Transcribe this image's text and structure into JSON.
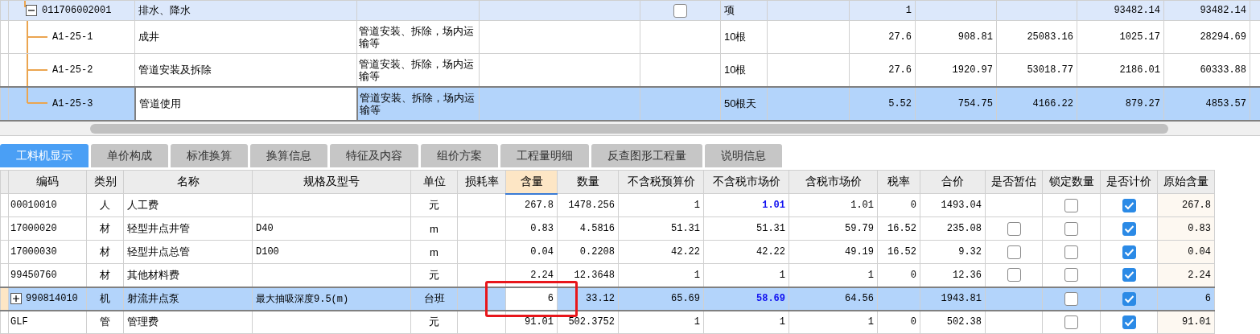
{
  "items": [
    {
      "code": "011706002001",
      "name": "排水、降水",
      "expanded": true,
      "selected": false,
      "checkbox": {
        "checked": false
      },
      "unit": "项",
      "column_8": "1",
      "column_11": "93482.14",
      "column_12": "93482.14",
      "children": [
        {
          "code": "A1-25-1",
          "name": "成井",
          "description": "管道安装、拆除，场内运输等",
          "unit": "10根",
          "column_8": "27.6",
          "column_9": "908.81",
          "column_10": "25083.16",
          "column_11": "1025.17",
          "column_12": "28294.69",
          "selected": false
        },
        {
          "code": "A1-25-2",
          "name": "管道安装及拆除",
          "description": "管道安装、拆除，场内运输等",
          "unit": "10根",
          "column_8": "27.6",
          "column_9": "1920.97",
          "column_10": "53018.77",
          "column_11": "2186.01",
          "column_12": "60333.88",
          "selected": false
        },
        {
          "code": "A1-25-3",
          "name": "管道使用",
          "description": "管道安装、拆除，场内运输等",
          "unit": "50根天",
          "column_8": "5.52",
          "column_9": "754.75",
          "column_10": "4166.22",
          "column_11": "879.27",
          "column_12": "4853.57",
          "selected": true
        }
      ]
    }
  ],
  "tabs": [
    {
      "label": "工料机显示",
      "selected": true
    },
    {
      "label": "单价构成",
      "selected": false
    },
    {
      "label": "标准换算",
      "selected": false
    },
    {
      "label": "换算信息",
      "selected": false
    },
    {
      "label": "特征及内容",
      "selected": false
    },
    {
      "label": "组价方案",
      "selected": false
    },
    {
      "label": "工程量明细",
      "selected": false
    },
    {
      "label": "反查图形工程量",
      "selected": false
    },
    {
      "label": "说明信息",
      "selected": false
    }
  ],
  "table": {
    "columns": [
      {
        "label": "编码",
        "selected": false
      },
      {
        "label": "类别",
        "selected": false
      },
      {
        "label": "名称",
        "selected": false
      },
      {
        "label": "规格及型号",
        "selected": false
      },
      {
        "label": "单位",
        "selected": false
      },
      {
        "label": "损耗率",
        "selected": false
      },
      {
        "label": "含量",
        "selected": true
      },
      {
        "label": "数量",
        "selected": false
      },
      {
        "label": "不含税预算价",
        "selected": false
      },
      {
        "label": "不含税市场价",
        "selected": false
      },
      {
        "label": "含税市场价",
        "selected": false
      },
      {
        "label": "税率",
        "selected": false
      },
      {
        "label": "合价",
        "selected": false
      },
      {
        "label": "是否暂估",
        "selected": false
      },
      {
        "label": "锁定数量",
        "selected": false
      },
      {
        "label": "是否计价",
        "selected": false
      },
      {
        "label": "原始含量",
        "selected": false
      }
    ],
    "rows": [
      {
        "code": "00010010",
        "category": "人",
        "name": "人工费",
        "unit": "元",
        "content": "267.8",
        "quantity": "1478.256",
        "budget_price": "1",
        "market_price": "1.01",
        "price_changed": true,
        "tax_price": "1.01",
        "tax_rate": "0",
        "total": "1493.04",
        "locked": false,
        "priced": true,
        "original": "267.8",
        "selected": false,
        "marked": false
      },
      {
        "code": "17000020",
        "category": "材",
        "name": "轻型井点井管",
        "spec": "D40",
        "unit": "m",
        "content": "0.83",
        "quantity": "4.5816",
        "budget_price": "51.31",
        "market_price": "51.31",
        "price_changed": false,
        "tax_price": "59.79",
        "tax_rate": "16.52",
        "total": "235.08",
        "provisional": false,
        "locked": false,
        "priced": true,
        "original": "0.83",
        "selected": false,
        "marked": false
      },
      {
        "code": "17000030",
        "category": "材",
        "name": "轻型井点总管",
        "spec": "D100",
        "unit": "m",
        "content": "0.04",
        "quantity": "0.2208",
        "budget_price": "42.22",
        "market_price": "42.22",
        "price_changed": false,
        "tax_price": "49.19",
        "tax_rate": "16.52",
        "total": "9.32",
        "provisional": false,
        "locked": false,
        "priced": true,
        "original": "0.04",
        "selected": false,
        "marked": false
      },
      {
        "code": "99450760",
        "category": "材",
        "name": "其他材料费",
        "unit": "元",
        "content": "2.24",
        "quantity": "12.3648",
        "budget_price": "1",
        "market_price": "1",
        "price_changed": false,
        "tax_price": "1",
        "tax_rate": "0",
        "total": "12.36",
        "provisional": false,
        "locked": false,
        "priced": true,
        "original": "2.24",
        "selected": false,
        "marked": false
      },
      {
        "code": "990814010",
        "expanded": false,
        "category": "机",
        "name": "射流井点泵",
        "spec": "最大抽吸深度9.5(m)",
        "unit": "台班",
        "content": "6",
        "quantity": "33.12",
        "budget_price": "65.69",
        "market_price": "58.69",
        "price_changed": true,
        "tax_price": "64.56",
        "total": "1943.81",
        "locked": false,
        "priced": true,
        "original": "6",
        "selected": true,
        "marked": true
      },
      {
        "code": "GLF",
        "category": "管",
        "name": "管理费",
        "unit": "元",
        "content": "91.01",
        "quantity": "502.3752",
        "budget_price": "1",
        "market_price": "1",
        "price_changed": false,
        "tax_price": "1",
        "tax_rate": "0",
        "total": "502.38",
        "locked": false,
        "priced": true,
        "original": "91.01",
        "selected": false,
        "marked": false
      }
    ]
  }
}
